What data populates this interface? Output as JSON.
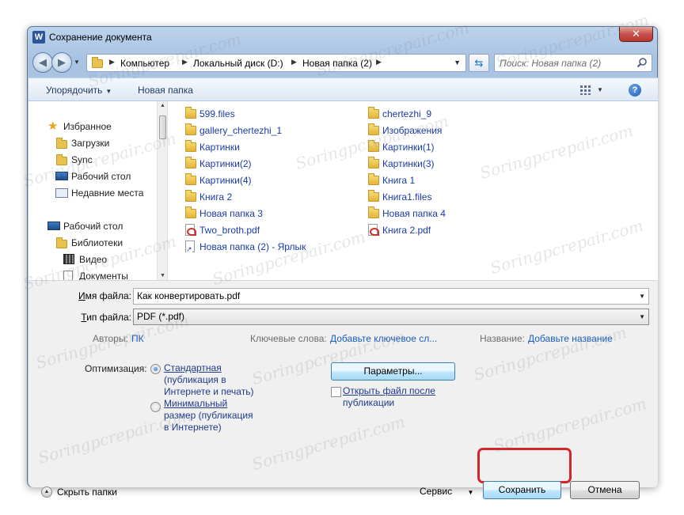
{
  "window": {
    "title": "Сохранение документа",
    "app_icon_letter": "W",
    "close_glyph": "✕"
  },
  "nav": {
    "back_glyph": "◀",
    "forward_glyph": "▶",
    "breadcrumbs": [
      "Компьютер",
      "Локальный диск (D:)",
      "Новая папка (2)"
    ],
    "search_placeholder": "Поиск: Новая папка (2)"
  },
  "toolbar": {
    "organize_label": "Упорядочить",
    "new_folder_label": "Новая папка",
    "help_glyph": "?"
  },
  "sidebar": {
    "items": [
      {
        "label": "Избранное",
        "icon": "star-icon"
      },
      {
        "label": "Загрузки",
        "icon": "downloads-folder-icon"
      },
      {
        "label": "Sync",
        "icon": "folder-icon"
      },
      {
        "label": "Рабочий стол",
        "icon": "desktop-icon"
      },
      {
        "label": "Недавние места",
        "icon": "recent-places-icon"
      },
      {
        "label": "Рабочий стол",
        "icon": "desktop-icon"
      },
      {
        "label": "Библиотеки",
        "icon": "libraries-icon"
      },
      {
        "label": "Видео",
        "icon": "video-icon"
      },
      {
        "label": "Документы",
        "icon": "documents-icon"
      }
    ]
  },
  "files": [
    {
      "name": "599.files",
      "type": "folder"
    },
    {
      "name": "gallery_chertezhi_1",
      "type": "folder"
    },
    {
      "name": "Картинки",
      "type": "folder"
    },
    {
      "name": "Картинки(2)",
      "type": "folder"
    },
    {
      "name": "Картинки(4)",
      "type": "folder"
    },
    {
      "name": "Книга 2",
      "type": "folder"
    },
    {
      "name": "Новая папка 3",
      "type": "folder"
    },
    {
      "name": "Two_broth.pdf",
      "type": "pdf"
    },
    {
      "name": "Новая папка (2) - Ярлык",
      "type": "shortcut"
    },
    {
      "name": "chertezhi_9",
      "type": "folder"
    },
    {
      "name": "Изображения",
      "type": "folder"
    },
    {
      "name": "Картинки(1)",
      "type": "folder"
    },
    {
      "name": "Картинки(3)",
      "type": "folder"
    },
    {
      "name": "Книга 1",
      "type": "folder"
    },
    {
      "name": "Книга1.files",
      "type": "folder"
    },
    {
      "name": "Новая папка 4",
      "type": "folder"
    },
    {
      "name": "Книга 2.pdf",
      "type": "pdf"
    }
  ],
  "form": {
    "filename_label_ul": "И",
    "filename_label_rest": "мя файла:",
    "filename_value": "Как конвертировать.pdf",
    "filetype_label_ul": "Т",
    "filetype_label_rest": "ип файла:",
    "filetype_value": "PDF (*.pdf)",
    "authors_label": "Авторы:",
    "authors_value": "ПК",
    "keywords_label": "Ключевые слова:",
    "keywords_value": "Добавьте ключевое сл...",
    "title_label": "Название:",
    "title_value": "Добавьте название",
    "optimization_label": "Оптимизация:",
    "opt_standard_1": "Стандартная",
    "opt_standard_2": "(публикация в",
    "opt_standard_3": "Интернете и печать)",
    "opt_minimal_1": "Минимальный",
    "opt_minimal_2": "размер (публикация",
    "opt_minimal_3": "в Интернете)",
    "params_button": "Параметры...",
    "open_after_1": "Открыть файл после",
    "open_after_2": "публикации"
  },
  "footer": {
    "hide_folders": "Скрыть папки",
    "service": "Сервис",
    "save_button": "Сохранить",
    "cancel_button": "Отмена"
  },
  "watermark": "Soringpcrepair.com"
}
